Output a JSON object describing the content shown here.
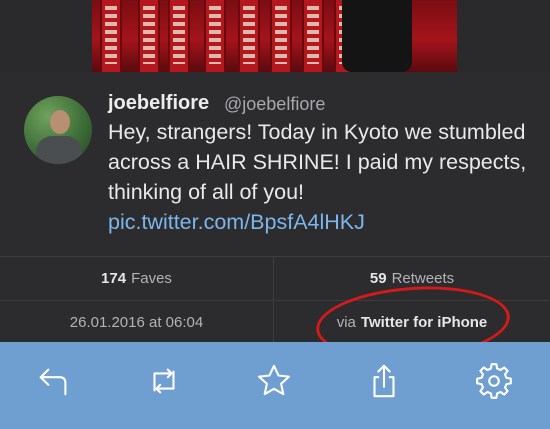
{
  "tweet": {
    "username": "joebelfiore",
    "handle": "@joebelfiore",
    "text_before_link": "Hey, strangers! Today in Kyoto we stumbled across a HAIR SHRINE! I paid my respects, thinking of all of you! ",
    "link": "pic.twitter.com/BpsfA4lHKJ"
  },
  "stats": {
    "faves_count": "174",
    "faves_label": "Faves",
    "retweets_count": "59",
    "retweets_label": "Retweets",
    "date": "26.01.2016 at 06:04",
    "via_label": "via",
    "source_app": "Twitter for iPhone"
  },
  "toolbar": {
    "items": [
      "reply-icon",
      "retweet-icon",
      "star-icon",
      "share-icon",
      "gear-icon"
    ],
    "background": "#6f9ed0"
  },
  "colors": {
    "link": "#7cb6ec",
    "highlight_circle": "#d41a1a"
  }
}
